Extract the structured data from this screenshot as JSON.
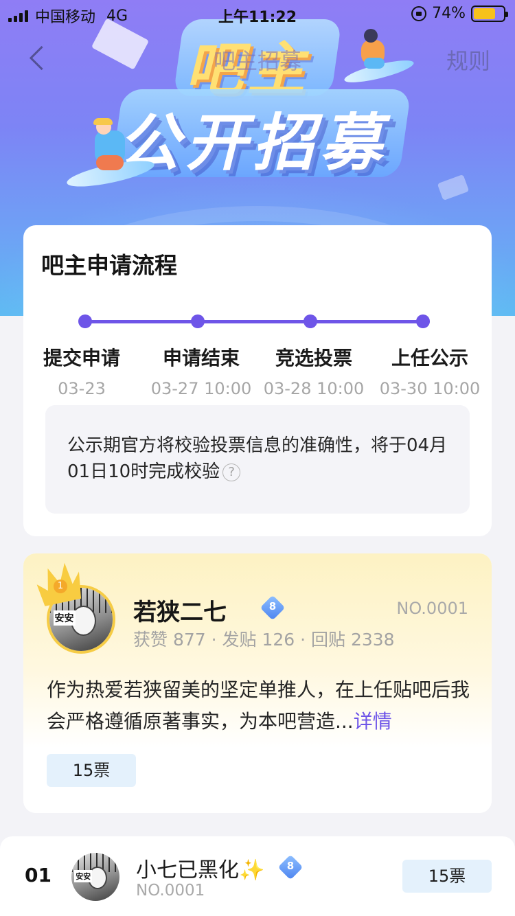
{
  "status_bar": {
    "carrier": "中国移动",
    "network": "4G",
    "time": "上午11:22",
    "battery_text": "74%",
    "battery_level": 0.74
  },
  "nav": {
    "title": "吧主招募",
    "rule_label": "规则"
  },
  "banner": {
    "title_top": "吧主",
    "title_bottom": "公开招募"
  },
  "flow": {
    "title": "吧主申请流程",
    "steps": [
      {
        "name": "提交申请",
        "date": "03-23"
      },
      {
        "name": "申请结束",
        "date": "03-27 10:00"
      },
      {
        "name": "竞选投票",
        "date": "03-28 10:00"
      },
      {
        "name": "上任公示",
        "date": "03-30 10:00"
      }
    ],
    "notice": "公示期官方将校验投票信息的准确性，将于04月01日10时完成校验",
    "help_glyph": "?"
  },
  "candidate": {
    "rank_badge": "1",
    "avatar_tag": "安安",
    "name": "若狭二七",
    "level": "8",
    "number": "NO.0001",
    "stats": "获赞 877 · 发贴 126 · 回贴 2338",
    "description": "作为热爱若狭留美的坚定单推人，在上任贴吧后我会严格遵循原著事实，为本吧营造...",
    "more_label": "详情",
    "votes": "15票"
  },
  "rank_list": [
    {
      "rank": "01",
      "avatar_tag": "安安",
      "name": "小七已黑化",
      "badge": "✨",
      "level": "8",
      "number": "NO.0001",
      "votes": "15票"
    }
  ],
  "colors": {
    "accent": "#6e55e8",
    "gold": "#f6cc45",
    "vote_bg": "#e4f1fc"
  }
}
